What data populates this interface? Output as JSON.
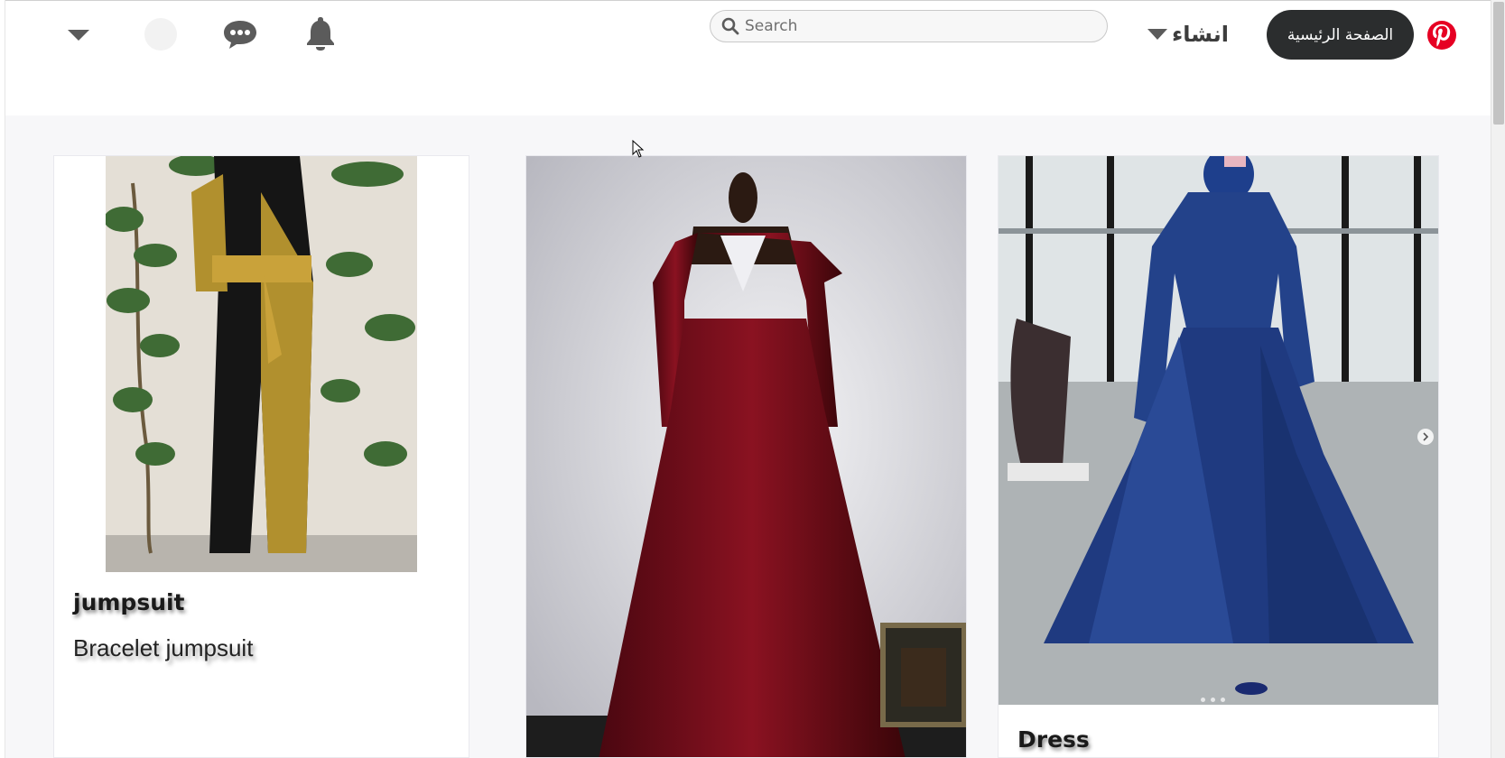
{
  "header": {
    "search_placeholder": "Search",
    "create_label": "انشاء",
    "home_label": "الصفحة الرئيسية"
  },
  "colors": {
    "brand": "#e60023",
    "home_button_bg": "#2b2d2e",
    "feed_bg": "#f7f7f9"
  },
  "icons": {
    "logo": "pinterest-logo-icon",
    "search": "search-icon",
    "notifications": "bell-icon",
    "messages": "chat-bubble-icon",
    "more": "chevron-down-icon"
  },
  "feed": {
    "cards": [
      {
        "title": "jumpsuit",
        "description": "Bracelet jumpsuit"
      },
      {
        "title": "",
        "description": ""
      },
      {
        "title": "Dress",
        "description": ""
      }
    ]
  }
}
